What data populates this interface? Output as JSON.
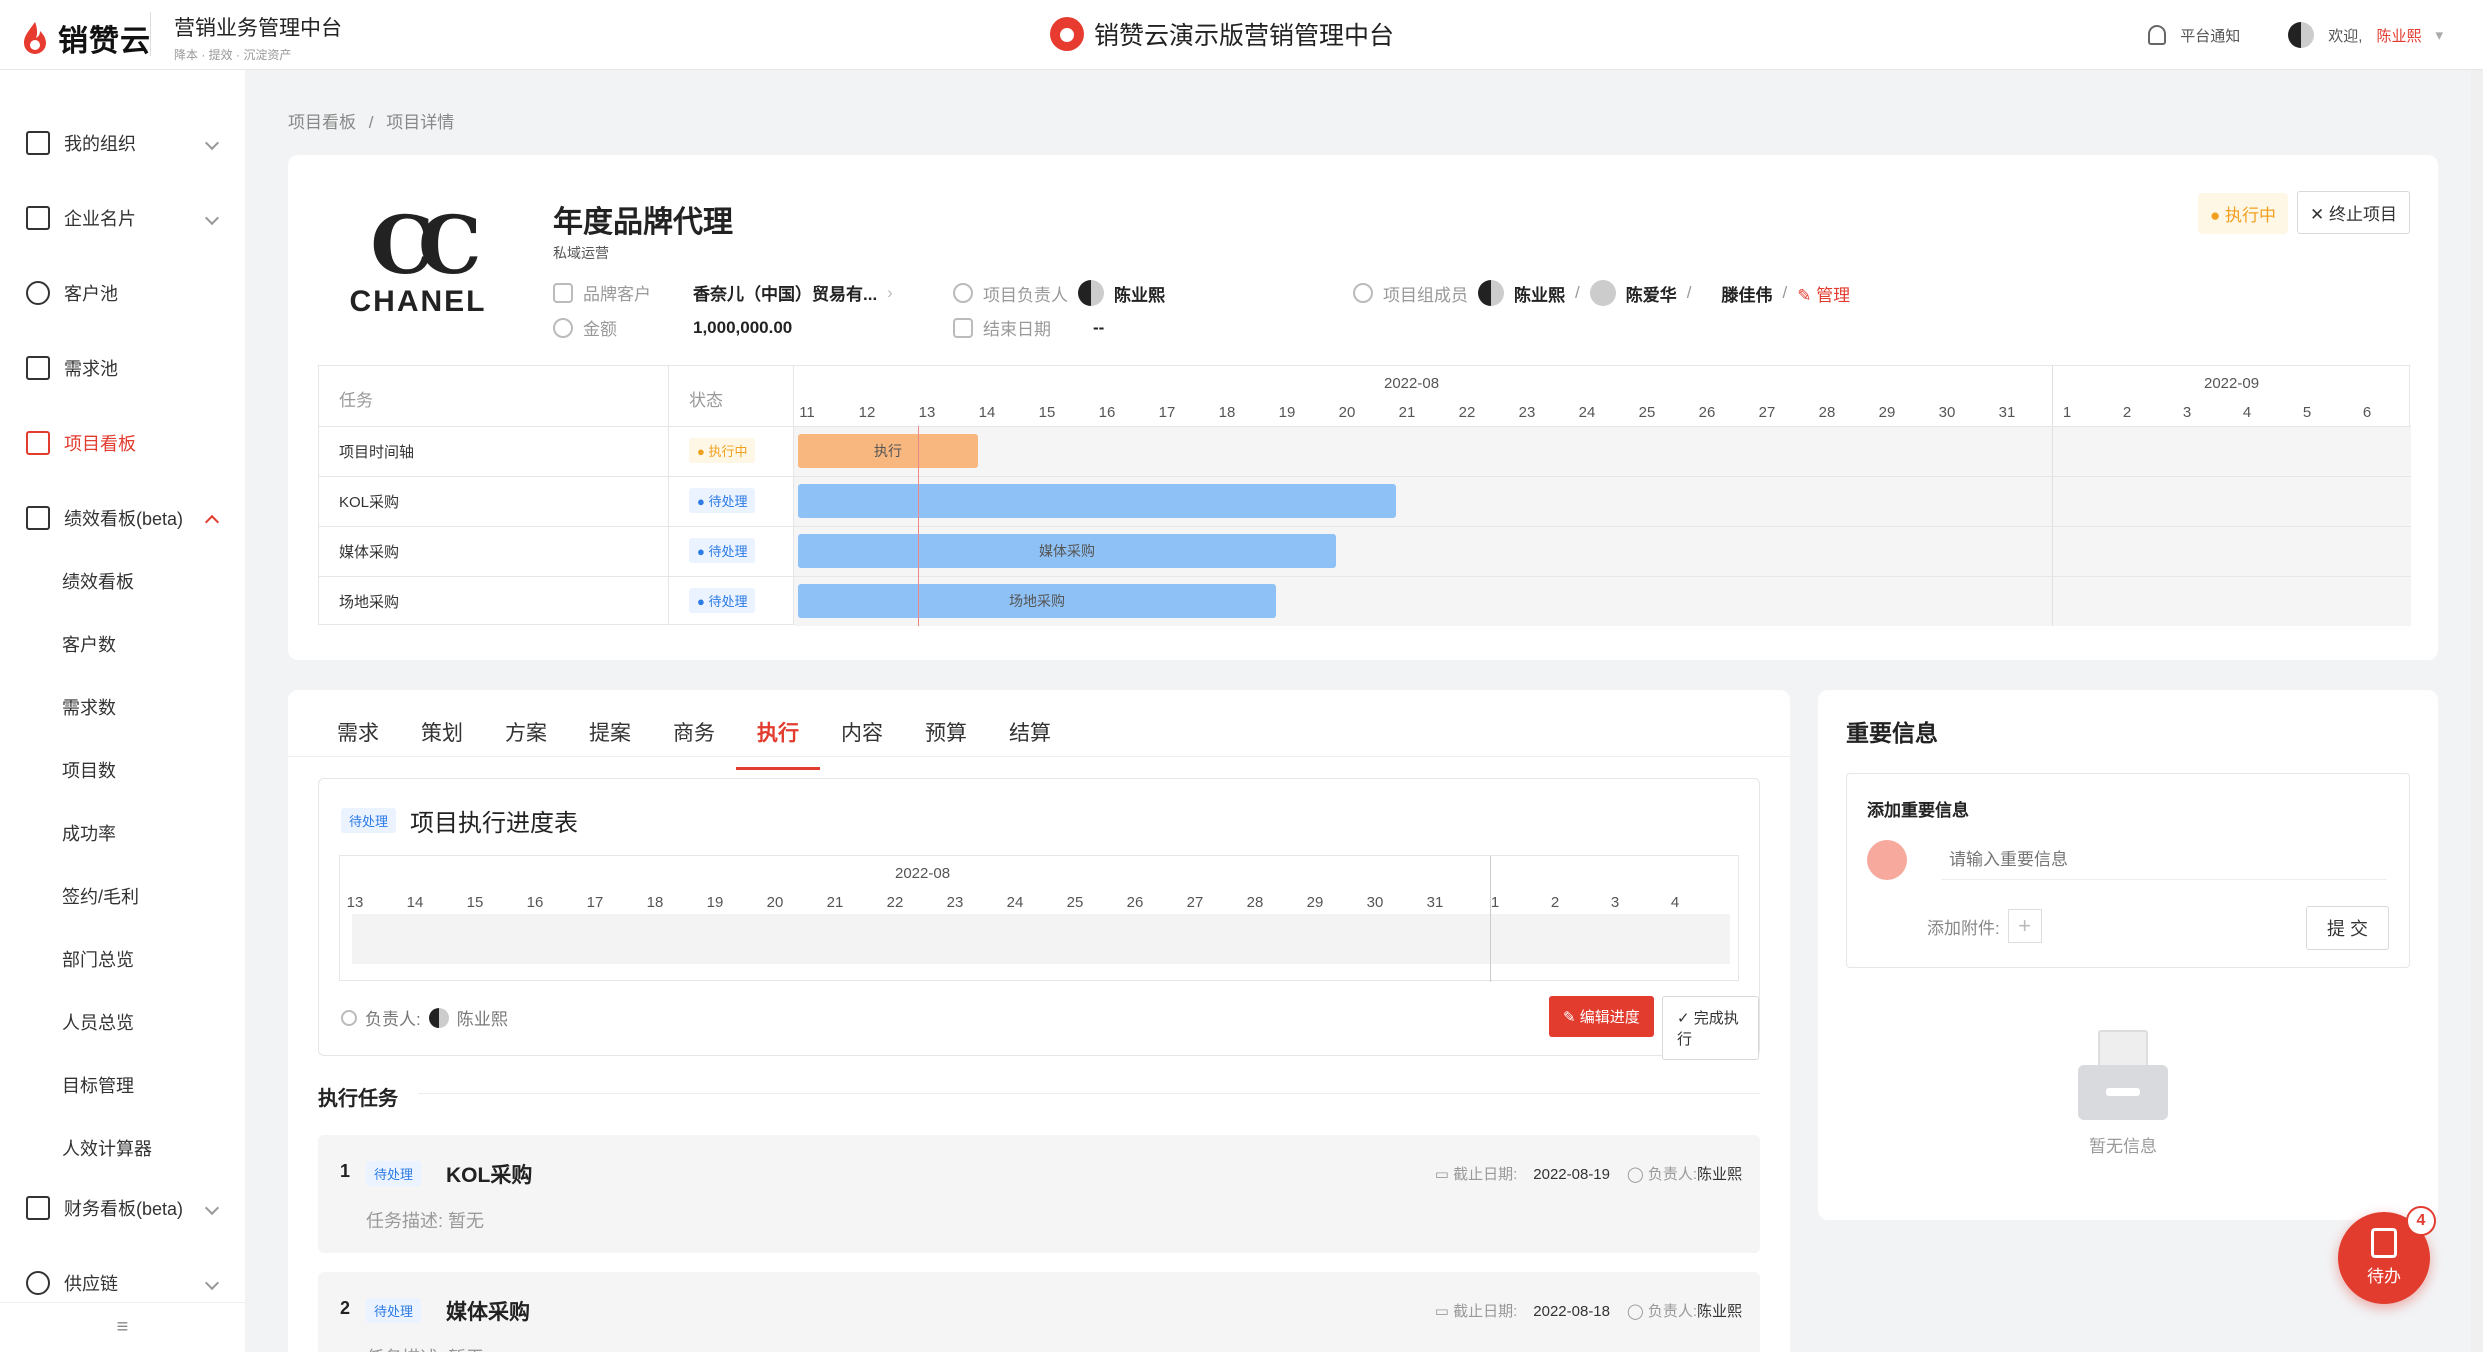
{
  "topbar": {
    "logo_text": "销赞云",
    "brand_title": "营销业务管理中台",
    "brand_slogan": "降本 · 提效 · 沉淀资产",
    "center_title": "销赞云演示版营销管理中台",
    "notice": "平台通知",
    "welcome": "欢迎,",
    "user": "陈业熙"
  },
  "sidebar": {
    "items": [
      {
        "label": "我的组织",
        "icon": "org-icon"
      },
      {
        "label": "企业名片",
        "icon": "company-icon"
      },
      {
        "label": "客户池",
        "icon": "user-icon"
      },
      {
        "label": "需求池",
        "icon": "list-icon"
      },
      {
        "label": "项目看板",
        "icon": "board-icon"
      },
      {
        "label": "绩效看板(beta)",
        "icon": "performance-icon"
      },
      {
        "label": "财务看板(beta)",
        "icon": "finance-icon"
      },
      {
        "label": "供应链",
        "icon": "supply-icon"
      }
    ],
    "subitems": [
      "绩效看板",
      "客户数",
      "需求数",
      "项目数",
      "成功率",
      "签约/毛利",
      "部门总览",
      "人员总览",
      "目标管理",
      "人效计算器"
    ]
  },
  "breadcrumb": {
    "root": "项目看板",
    "sep": "/",
    "current": "项目详情"
  },
  "project": {
    "brand_logo": "CHANEL",
    "title": "年度品牌代理",
    "subtitle": "私域运营",
    "brand_client_label": "品牌客户",
    "brand_client_value": "香奈儿（中国）贸易有...",
    "amount_label": "金额",
    "amount_value": "1,000,000.00",
    "owner_label": "项目负责人",
    "owner_value": "陈业熙",
    "end_label": "结束日期",
    "end_value": "--",
    "members_label": "项目组成员",
    "members": [
      "陈业熙",
      "陈爱华",
      "滕佳伟"
    ],
    "manage": "管理",
    "status": "执行中",
    "stop_button": "终止项目"
  },
  "gantt": {
    "head_task": "任务",
    "head_state": "状态",
    "months": [
      "2022-08",
      "2022-09"
    ],
    "aug_days": [
      "11",
      "12",
      "13",
      "14",
      "15",
      "16",
      "17",
      "18",
      "19",
      "20",
      "21",
      "22",
      "23",
      "24",
      "25",
      "26",
      "27",
      "28",
      "29",
      "30",
      "31"
    ],
    "sep_days": [
      "1",
      "2",
      "3",
      "4",
      "5",
      "6"
    ],
    "rows": [
      {
        "task": "项目时间轴",
        "state": "执行中",
        "bar_label": "执行",
        "start": 11,
        "end": 14,
        "color": "#f8b77f"
      },
      {
        "task": "KOL采购",
        "state": "待处理",
        "bar_label": "",
        "start": 11,
        "end": 19,
        "color": "#8ec1f6"
      },
      {
        "task": "媒体采购",
        "state": "待处理",
        "bar_label": "媒体采购",
        "start": 11,
        "end": 18,
        "color": "#8ec1f6"
      },
      {
        "task": "场地采购",
        "state": "待处理",
        "bar_label": "场地采购",
        "start": 11,
        "end": 17,
        "color": "#8ec1f6"
      }
    ]
  },
  "tabs": [
    "需求",
    "策划",
    "方案",
    "提案",
    "商务",
    "执行",
    "内容",
    "预算",
    "结算"
  ],
  "active_tab": "执行",
  "schedule": {
    "badge": "待处理",
    "title": "项目执行进度表",
    "month": "2022-08",
    "aug_days": [
      "13",
      "14",
      "15",
      "16",
      "17",
      "18",
      "19",
      "20",
      "21",
      "22",
      "23",
      "24",
      "25",
      "26",
      "27",
      "28",
      "29",
      "30",
      "31"
    ],
    "sep_days": [
      "1",
      "2",
      "3",
      "4"
    ],
    "owner_label": "负责人:",
    "owner": "陈业熙",
    "edit_button": "编辑进度",
    "done_button": "完成执行"
  },
  "tasks_section": "执行任务",
  "tasks": [
    {
      "num": "1",
      "badge": "待处理",
      "name": "KOL采购",
      "desc": "任务描述:  暂无",
      "due_label": "截止日期:",
      "due": "2022-08-19",
      "owner_label": "负责人:",
      "owner": "陈业熙"
    },
    {
      "num": "2",
      "badge": "待处理",
      "name": "媒体采购",
      "desc": "任务描述:  暂无",
      "due_label": "截止日期:",
      "due": "2022-08-18",
      "owner_label": "负责人:",
      "owner": "陈业熙"
    }
  ],
  "info": {
    "title": "重要信息",
    "add_title": "添加重要信息",
    "placeholder": "请输入重要信息",
    "attach": "添加附件:",
    "submit": "提 交",
    "empty": "暂无信息"
  },
  "fab": {
    "label": "待办",
    "count": "4"
  }
}
